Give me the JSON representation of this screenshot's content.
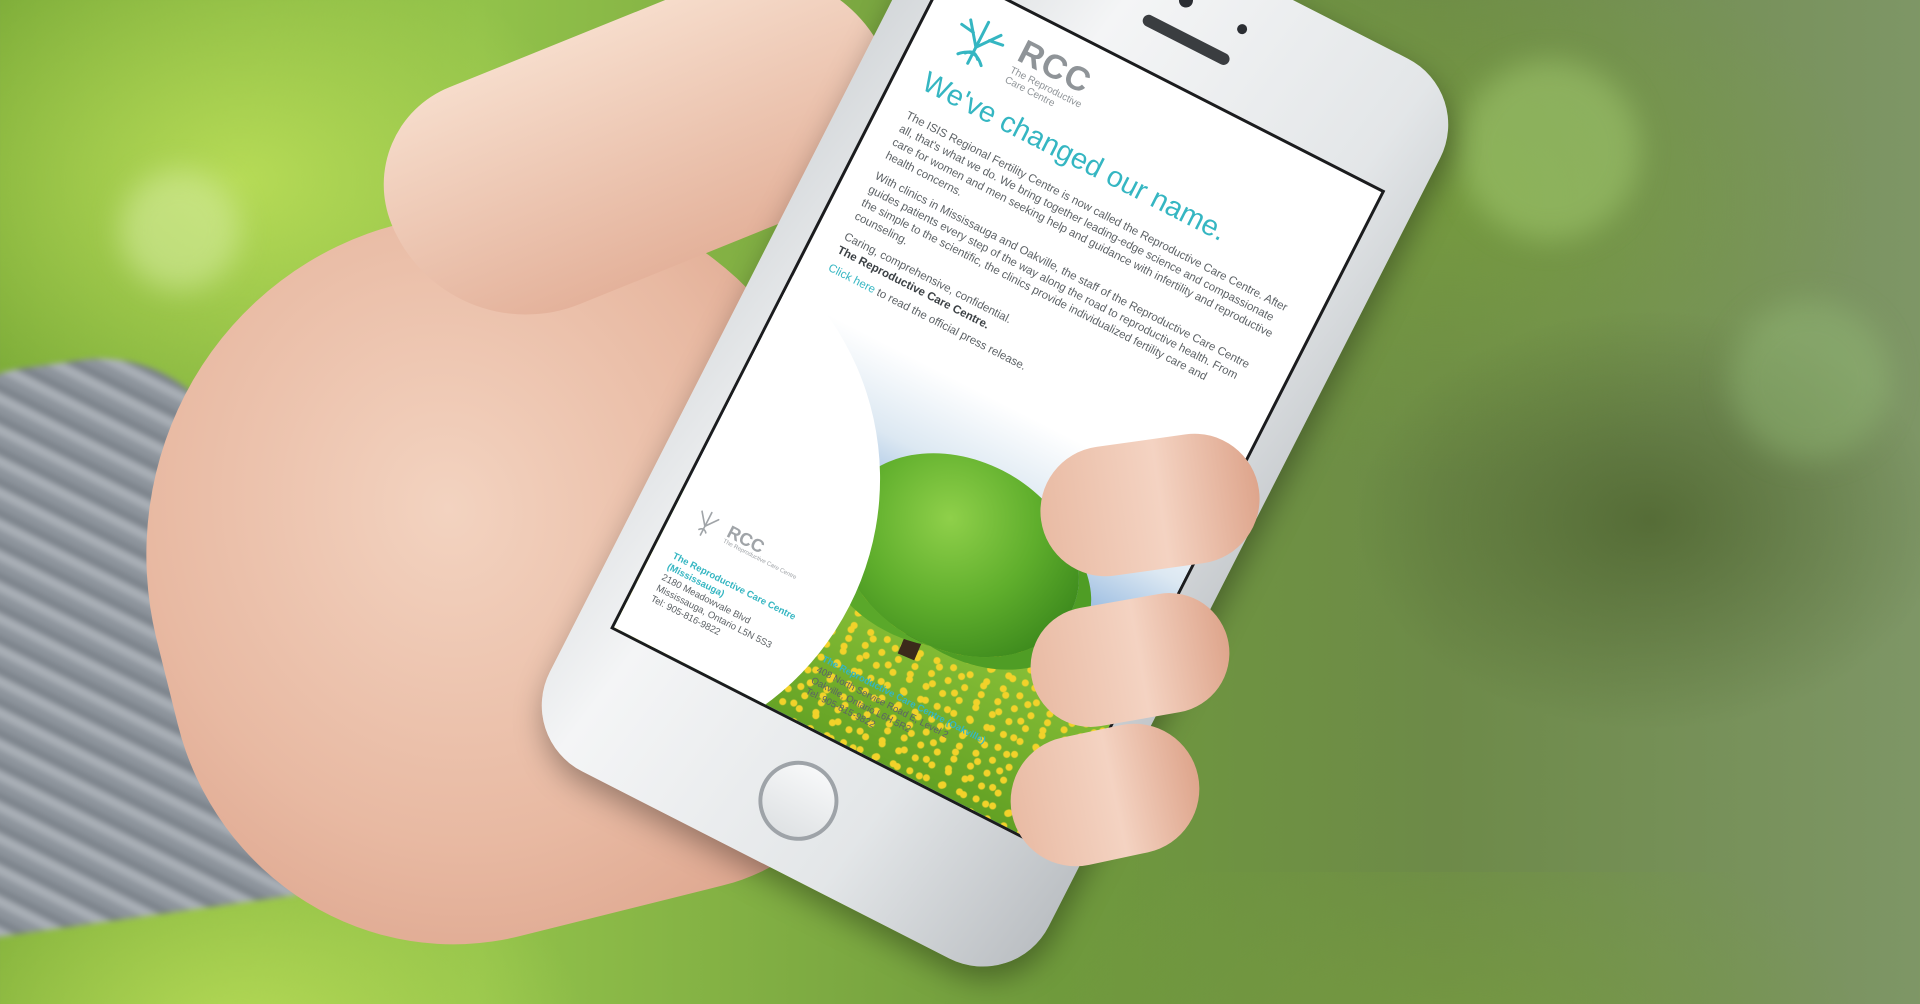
{
  "scene": {
    "subject": "hand holding smartphone",
    "background_colors": [
      "#7fae3a",
      "#92c24a",
      "#6d8a48"
    ]
  },
  "email": {
    "logo": {
      "abbr": "RCC",
      "name_line1": "The Reproductive",
      "name_line2": "Care Centre"
    },
    "headline": "We've changed our name.",
    "paragraphs": [
      "The ISIS Regional Fertility Centre is now called the Reproductive Care Centre. After all, that's what we do. We bring together leading-edge science and compassionate care for women and men seeking help and guidance with infertility and reproductive health concerns.",
      "With clinics in Mississauga and Oakville, the staff of the Reproductive Care Centre guides patients every step of the way along the road to reproductive health. From the simple to the scientific, the clinics provide individualized fertility care and counseling.",
      "Caring, comprehensive, confidential."
    ],
    "signature": "The Reproductive Care Centre.",
    "link_text": "Click here",
    "link_suffix": " to read the official press release.",
    "footer": {
      "logo_abbr": "RCC",
      "logo_sub": "The Reproductive Care Centre",
      "locations": [
        {
          "title": "The Reproductive Care Centre (Mississauga)",
          "address1": "2180 Meadowvale Blvd",
          "address2": "Mississauga, Ontario L5N 5S3",
          "phone": "Tel: 905-816-9822"
        },
        {
          "title": "The Reproductive Care Centre (Oakville)",
          "address1": "408 North Service Road E, Level 2",
          "address2": "Oakville, Ontario L6H 5R2",
          "phone": "Tel: 905-815-9822"
        }
      ]
    },
    "accent_color": "#35b6c2"
  }
}
